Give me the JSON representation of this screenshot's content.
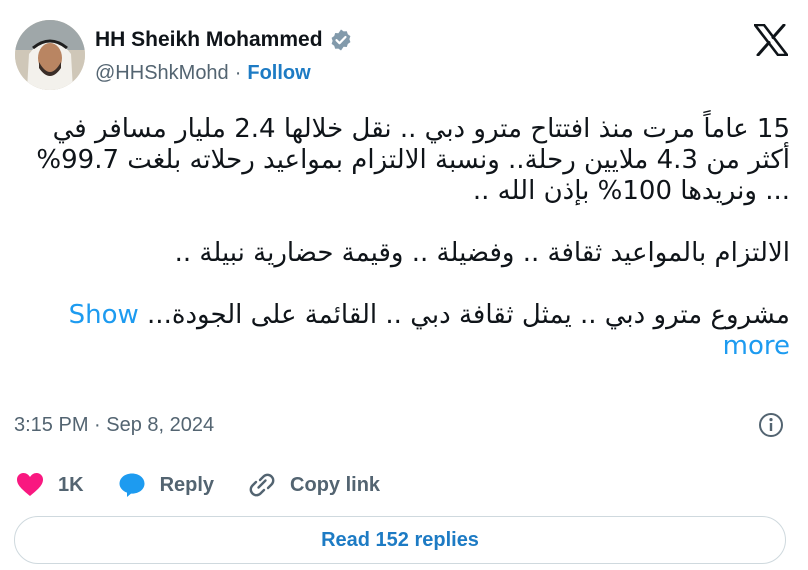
{
  "author": {
    "name": "HH Sheikh Mohammed",
    "handle": "@HHShkMohd",
    "separator": "·",
    "follow_label": "Follow"
  },
  "icons": {
    "verified": "verified-badge-icon",
    "x_logo": "x-logo-icon",
    "info": "info-icon",
    "like": "heart-icon",
    "reply": "reply-bubble-icon",
    "copy": "link-icon"
  },
  "tweet": {
    "lines": [
      "15 عاماً مرت منذ افتتاح مترو دبي .. نقل خلالها 2.4 مليار مسافر في أكثر من 4.3 ملايين رحلة.. ونسبة الالتزام بمواعيد رحلاته بلغت 99.7% ... ونريدها 100% بإذن الله ..",
      "الالتزام بالمواعيد ثقافة .. وفضيلة .. وقيمة حضارية نبيلة ..",
      "مشروع مترو دبي .. يمثل ثقافة دبي .. القائمة على الجودة..."
    ],
    "show_more": "Show more"
  },
  "meta": {
    "timestamp": "3:15 PM · Sep 8, 2024"
  },
  "actions": {
    "likes": "1K",
    "reply_label": "Reply",
    "copy_label": "Copy link"
  },
  "read_replies": "Read 152 replies",
  "colors": {
    "accent": "#1d9bf0",
    "heart": "#f91880",
    "verified": "#829aab",
    "text": "#0f1419",
    "secondary": "#536471"
  }
}
